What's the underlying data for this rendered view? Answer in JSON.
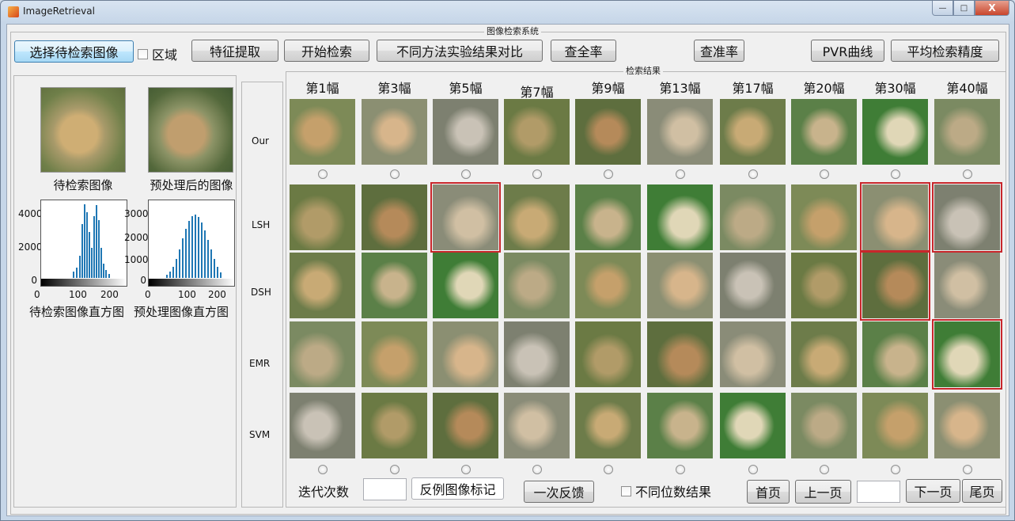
{
  "window": {
    "title": "ImageRetrieval",
    "controls": [
      "—",
      "□",
      "X"
    ]
  },
  "system_panel": {
    "title": "图像检索系统"
  },
  "toolbar": {
    "select_query": "选择待检索图像",
    "region_label": "区域",
    "feature_extract": "特征提取",
    "start_search": "开始检索",
    "compare_methods": "不同方法实验结果对比",
    "recall": "查全率",
    "precision": "查准率",
    "pvr_curve": "PVR曲线",
    "avg_precision": "平均检索精度"
  },
  "left_panel": {
    "query_caption": "待检索图像",
    "processed_caption": "预处理后的图像",
    "query_hist_caption": "待检索图像直方图",
    "processed_hist_caption": "预处理图像直方图",
    "hist1": {
      "yticks": [
        "4000",
        "2000",
        "0"
      ],
      "xticks": [
        "0",
        "100",
        "200"
      ]
    },
    "hist2": {
      "yticks": [
        "3000",
        "2000",
        "1000",
        "0"
      ],
      "xticks": [
        "0",
        "100",
        "200"
      ]
    }
  },
  "results": {
    "title": "检索结果",
    "columns": [
      "第1幅",
      "第3幅",
      "第5幅",
      "第7幅",
      "第9幅",
      "第13幅",
      "第17幅",
      "第20幅",
      "第30幅",
      "第40幅"
    ],
    "rows": [
      "Our",
      "LSH",
      "DSH",
      "EMR",
      "SVM"
    ]
  },
  "bottom": {
    "iter_label": "迭代次数",
    "iter_value": "",
    "neg_mark": "反例图像标记",
    "feedback": "一次反馈",
    "diff_bits": "不同位数结果",
    "first_page": "首页",
    "prev_page": "上一页",
    "page_value": "",
    "next_page": "下一页",
    "last_page": "尾页"
  },
  "colors": {
    "highlight": "#c8262b",
    "focus": "#3c7fb1",
    "histogram_bar": "#1f77b4"
  }
}
